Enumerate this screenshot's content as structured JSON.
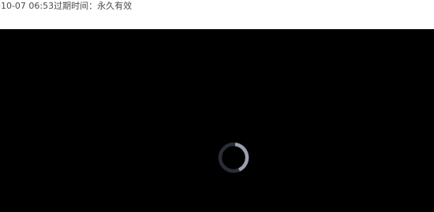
{
  "info": {
    "text": "-10-07 06:53过期时间：永久有效"
  },
  "player": {
    "loading_icon": "loading-spinner-icon",
    "colors": {
      "background": "#000000",
      "spinner_track": "#2a2d36",
      "spinner_arc": "#9aa0ab"
    }
  }
}
